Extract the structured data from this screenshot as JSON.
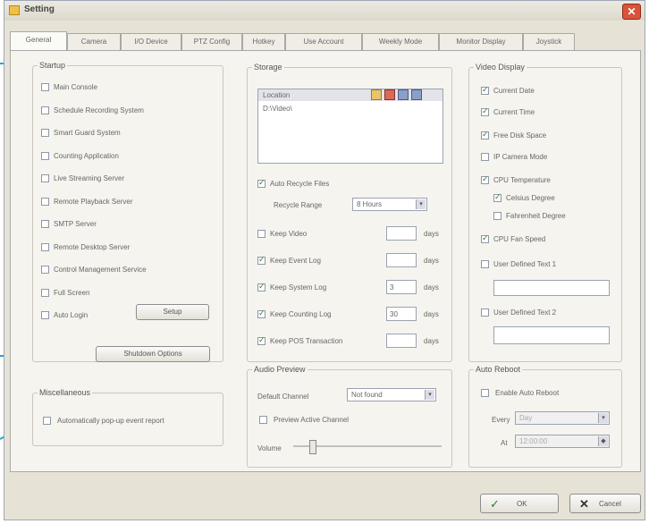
{
  "window": {
    "title": "Setting",
    "close_glyph": "✕"
  },
  "tabs": [
    "General",
    "Camera",
    "I/O Device",
    "PTZ Config",
    "Hotkey",
    "Use Account",
    "Weekly Mode",
    "Monitor Display",
    "Joystick"
  ],
  "startup": {
    "title": "Startup",
    "items": [
      {
        "label": "Main Console",
        "checked": false
      },
      {
        "label": "Schedule Recording System",
        "checked": false
      },
      {
        "label": "Smart Guard System",
        "checked": false
      },
      {
        "label": "Counting Application",
        "checked": false
      },
      {
        "label": "Live Streaming Server",
        "checked": false
      },
      {
        "label": "Remote Playback Server",
        "checked": false
      },
      {
        "label": "SMTP Server",
        "checked": false
      },
      {
        "label": "Remote Desktop Server",
        "checked": false
      },
      {
        "label": "Control Management Service",
        "checked": false
      },
      {
        "label": "Full Screen",
        "checked": false
      },
      {
        "label": "Auto Login",
        "checked": false
      }
    ],
    "setup_button": "Setup",
    "shutdown_button": "Shutdown Options"
  },
  "miscellaneous": {
    "title": "Miscellaneous",
    "item": "Automatically pop-up event report"
  },
  "storage": {
    "title": "Storage",
    "location_label": "Location",
    "location_value": "D:\\Video\\",
    "recycle_label": "Auto Recycle Files",
    "recycle_checked": true,
    "recycle_range_label": "Recycle Range",
    "recycle_range_value": "8 Hours",
    "rows": [
      {
        "label": "Keep Video",
        "value": "",
        "unit": "days",
        "checked": false
      },
      {
        "label": "Keep Event Log",
        "value": "",
        "unit": "days",
        "checked": true
      },
      {
        "label": "Keep System Log",
        "value": "3",
        "unit": "days",
        "checked": true
      },
      {
        "label": "Keep Counting Log",
        "value": "30",
        "unit": "days",
        "checked": true
      },
      {
        "label": "Keep POS Transaction",
        "value": "",
        "unit": "days",
        "checked": true
      }
    ]
  },
  "audio": {
    "title": "Audio Preview",
    "default_channel_label": "Default Channel",
    "default_channel_value": "Not found",
    "preview_label": "Preview Active Channel",
    "volume_label": "Volume"
  },
  "video": {
    "title": "Video Display",
    "items": [
      {
        "label": "Current Date",
        "checked": true
      },
      {
        "label": "Current Time",
        "checked": true
      },
      {
        "label": "Free Disk Space",
        "checked": true
      },
      {
        "label": "IP Camera Mode",
        "checked": false
      },
      {
        "label": "CPU Temperature",
        "checked": true
      },
      {
        "label": "Celsius Degree",
        "checked": true
      },
      {
        "label": "Fahrenheit Degree",
        "checked": false
      },
      {
        "label": "CPU Fan Speed",
        "checked": true
      },
      {
        "label": "User Defined Text 1",
        "checked": false
      },
      {
        "label": "User Defined Text 2",
        "checked": false
      }
    ]
  },
  "autoreboot": {
    "title": "Auto Reboot",
    "enable_label": "Enable Auto Reboot",
    "every_label": "Every",
    "every_value": "Day",
    "at_label": "At",
    "at_value": "12:00:00"
  },
  "footer": {
    "ok": "OK",
    "cancel": "Cancel"
  },
  "colors": {
    "callout": "#2f9fd6",
    "close": "#d9533a"
  }
}
